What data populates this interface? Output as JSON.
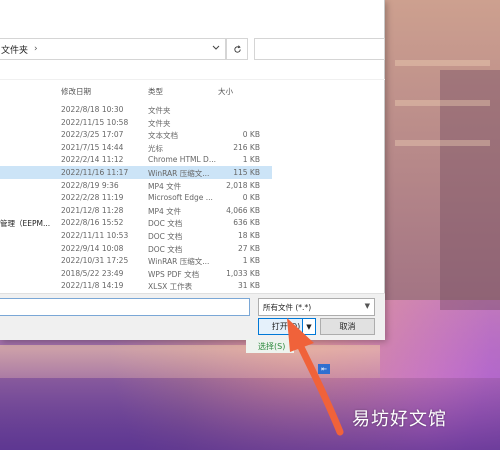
{
  "dialog": {
    "address_segment": "文件夹",
    "address_separator": "›",
    "chevron_icon": "chevron-down-icon",
    "refresh_icon": "refresh-icon"
  },
  "columns": {
    "date": "修改日期",
    "type": "类型",
    "size": "大小"
  },
  "files": [
    {
      "name": "",
      "date": "2022/8/18 10:30",
      "type": "文件夹",
      "size": ""
    },
    {
      "name": "",
      "date": "2022/11/15 10:58",
      "type": "文件夹",
      "size": ""
    },
    {
      "name": "",
      "date": "2022/3/25 17:07",
      "type": "文本文档",
      "size": "0 KB"
    },
    {
      "name": "",
      "date": "2021/7/15 14:44",
      "type": "光标",
      "size": "216 KB"
    },
    {
      "name": "",
      "date": "2022/2/14 11:12",
      "type": "Chrome HTML D...",
      "size": "1 KB"
    },
    {
      "name": "",
      "date": "2022/11/16 11:17",
      "type": "WinRAR 压缩文...",
      "size": "115 KB",
      "selected": true
    },
    {
      "name": "",
      "date": "2022/8/19 9:36",
      "type": "MP4 文件",
      "size": "2,018 KB"
    },
    {
      "name": "",
      "date": "2022/2/28 11:19",
      "type": "Microsoft Edge ...",
      "size": "0 KB"
    },
    {
      "name": "",
      "date": "2021/12/8 11:28",
      "type": "MP4 文件",
      "size": "4,066 KB"
    },
    {
      "name": "管理（EEPM...",
      "date": "2022/8/16 15:52",
      "type": "DOC 文档",
      "size": "636 KB"
    },
    {
      "name": "",
      "date": "2022/11/11 10:53",
      "type": "DOC 文档",
      "size": "18 KB"
    },
    {
      "name": "",
      "date": "2022/9/14 10:08",
      "type": "DOC 文档",
      "size": "27 KB"
    },
    {
      "name": "",
      "date": "2022/10/31 17:25",
      "type": "WinRAR 压缩文...",
      "size": "1 KB"
    },
    {
      "name": "",
      "date": "2018/5/22 23:49",
      "type": "WPS PDF 文档",
      "size": "1,033 KB"
    },
    {
      "name": "",
      "date": "2022/11/8 14:19",
      "type": "XLSX 工作表",
      "size": "31 KB"
    }
  ],
  "bottom": {
    "filename_value": "",
    "filter_label": "所有文件 (*.*)",
    "open_label": "打开(O)",
    "cancel_label": "取消"
  },
  "page_extra": {
    "select_link": "选择(S)"
  },
  "watermark": "易坊好文馆",
  "colors": {
    "selection": "#cce4f7",
    "accent": "#0078d7",
    "arrow": "#f0623a"
  }
}
